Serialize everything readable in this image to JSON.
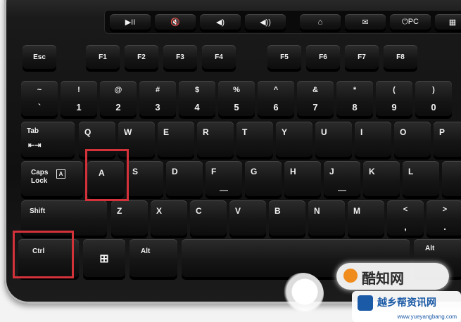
{
  "media_keys": [
    {
      "name": "play-pause-key",
      "label": "▶II"
    },
    {
      "name": "mute-key",
      "label": "🔇"
    },
    {
      "name": "volume-down-key",
      "label": "◀)"
    },
    {
      "name": "volume-up-key",
      "label": "◀))"
    },
    {
      "name": "home-key",
      "label": "⌂"
    },
    {
      "name": "mail-key",
      "label": "✉"
    },
    {
      "name": "sleep-key",
      "label": "⏻PC"
    },
    {
      "name": "calculator-key",
      "label": "▦"
    }
  ],
  "function_keys": [
    "Esc",
    "F1",
    "F2",
    "F3",
    "F4",
    "F5",
    "F6",
    "F7",
    "F8"
  ],
  "number_row": [
    {
      "top": "~",
      "bot": "`"
    },
    {
      "top": "!",
      "bot": "1"
    },
    {
      "top": "@",
      "bot": "2"
    },
    {
      "top": "#",
      "bot": "3"
    },
    {
      "top": "$",
      "bot": "4"
    },
    {
      "top": "%",
      "bot": "5"
    },
    {
      "top": "^",
      "bot": "6"
    },
    {
      "top": "&",
      "bot": "7"
    },
    {
      "top": "*",
      "bot": "8"
    },
    {
      "top": "(",
      "bot": "9"
    },
    {
      "top": ")",
      "bot": "0"
    }
  ],
  "tab_key": {
    "label": "Tab",
    "icon": "⇤⇥"
  },
  "qwerty_row": [
    "Q",
    "W",
    "E",
    "R",
    "T",
    "Y",
    "U",
    "I",
    "O",
    "P"
  ],
  "caps_key": {
    "line1": "Caps",
    "line2": "Lock",
    "icon": "A"
  },
  "home_row": [
    "A",
    "S",
    "D",
    "F",
    "G",
    "H",
    "J",
    "K",
    "L"
  ],
  "shift_key": "Shift",
  "bottom_row": [
    "Z",
    "X",
    "C",
    "V",
    "B",
    "N",
    "M"
  ],
  "comma_key": {
    "top": "<",
    "bot": ","
  },
  "period_key": {
    "top": ">",
    "bot": "."
  },
  "ctrl_key": "Ctrl",
  "windows_key": {
    "icon": "⊞"
  },
  "alt_left": "Alt",
  "alt_right": "Alt",
  "highlight_color": "#d4323a",
  "watermark": {
    "brand": "酷知网",
    "site": "www.yueyangbang.com",
    "site_cn": "越乡帮资讯网"
  }
}
